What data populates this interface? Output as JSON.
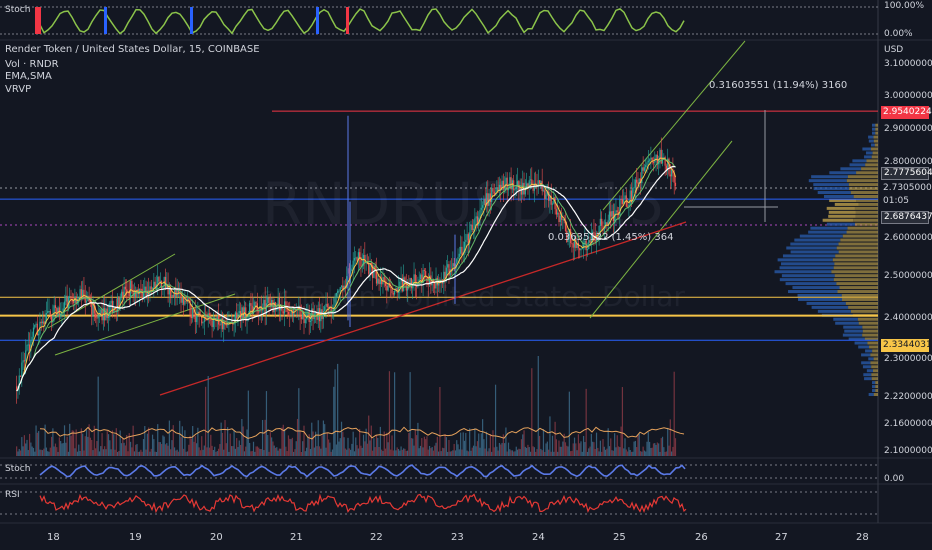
{
  "header": {
    "title": "Render Token / United States Dollar, 15, COINBASE",
    "indicators": [
      "Vol · RNDR",
      "EMA,SMA",
      "VRVP"
    ]
  },
  "watermark": {
    "symbol": "RNDRUSD, 15",
    "name": "Render Token / United States Dollar"
  },
  "top_pane": {
    "label": "Stoch",
    "scale_top": "100.00%",
    "scale_bottom": "0.00%"
  },
  "price_axis": {
    "currency": "USD",
    "ticks": [
      "3.10000000",
      "3.00000000",
      "2.90000000",
      "2.80000000",
      "2.60000000",
      "2.50000000",
      "2.40000000",
      "2.30000000",
      "2.22000000",
      "2.16000000",
      "2.10000000"
    ],
    "stoch_zero": "0.00"
  },
  "price_tags": {
    "red": "2.95402242",
    "last": "2.77756044",
    "current": "2.73050000",
    "countdown": "01:05",
    "mid": "2.68764379",
    "yellow": "2.33440318"
  },
  "annotations": {
    "upper": "0.31603551 (11.94%) 3160",
    "lower": "0.03635122 (1.45%) 364"
  },
  "lower_panes": {
    "stoch_label": "Stoch",
    "rsi_label": "RSI"
  },
  "time_axis": [
    "18",
    "19",
    "20",
    "21",
    "22",
    "23",
    "24",
    "25",
    "26",
    "27",
    "28"
  ],
  "colors": {
    "bg": "#131722",
    "up": "#26a69a",
    "down": "#ef5350",
    "red_line": "#f23645",
    "yellow_line": "#f7c548",
    "blue_line": "#2962ff",
    "rsi": "#e53935",
    "stoch": "#5b7ae8"
  },
  "chart_data": {
    "type": "candlestick",
    "title": "Render Token / United States Dollar, 15, COINBASE",
    "x_axis": {
      "ticks": [
        "18",
        "19",
        "20",
        "21",
        "22",
        "23",
        "24",
        "25",
        "26",
        "27",
        "28"
      ],
      "label": ""
    },
    "y_axis": {
      "label": "USD",
      "range": [
        2.1,
        3.1
      ]
    },
    "close_path": [
      [
        17.6,
        2.12
      ],
      [
        17.8,
        2.28
      ],
      [
        18.0,
        2.33
      ],
      [
        18.2,
        2.37
      ],
      [
        18.4,
        2.4
      ],
      [
        18.6,
        2.33
      ],
      [
        18.8,
        2.36
      ],
      [
        19.0,
        2.42
      ],
      [
        19.2,
        2.4
      ],
      [
        19.4,
        2.44
      ],
      [
        19.6,
        2.39
      ],
      [
        19.8,
        2.34
      ],
      [
        20.0,
        2.32
      ],
      [
        20.2,
        2.3
      ],
      [
        20.4,
        2.34
      ],
      [
        20.6,
        2.36
      ],
      [
        20.8,
        2.37
      ],
      [
        21.0,
        2.35
      ],
      [
        21.2,
        2.33
      ],
      [
        21.4,
        2.34
      ],
      [
        21.6,
        2.4
      ],
      [
        21.8,
        2.52
      ],
      [
        22.0,
        2.47
      ],
      [
        22.2,
        2.41
      ],
      [
        22.4,
        2.43
      ],
      [
        22.6,
        2.45
      ],
      [
        22.8,
        2.44
      ],
      [
        23.0,
        2.48
      ],
      [
        23.2,
        2.58
      ],
      [
        23.4,
        2.68
      ],
      [
        23.6,
        2.74
      ],
      [
        23.8,
        2.72
      ],
      [
        24.0,
        2.73
      ],
      [
        24.2,
        2.7
      ],
      [
        24.4,
        2.58
      ],
      [
        24.6,
        2.53
      ],
      [
        24.8,
        2.6
      ],
      [
        25.0,
        2.65
      ],
      [
        25.2,
        2.7
      ],
      [
        25.4,
        2.8
      ],
      [
        25.6,
        2.82
      ],
      [
        25.75,
        2.73
      ]
    ],
    "horizontal_levels": [
      {
        "price": 2.95402242,
        "color": "red"
      },
      {
        "price": 2.68764379,
        "color": "blue"
      },
      {
        "price": 2.39,
        "color": "yellow"
      },
      {
        "price": 2.33440318,
        "color": "yellow"
      },
      {
        "price": 2.26,
        "color": "blue"
      }
    ],
    "volume_profile_range": [
      2.1,
      2.9
    ],
    "legend": [
      "Vol · RNDR",
      "EMA,SMA",
      "VRVP"
    ]
  }
}
